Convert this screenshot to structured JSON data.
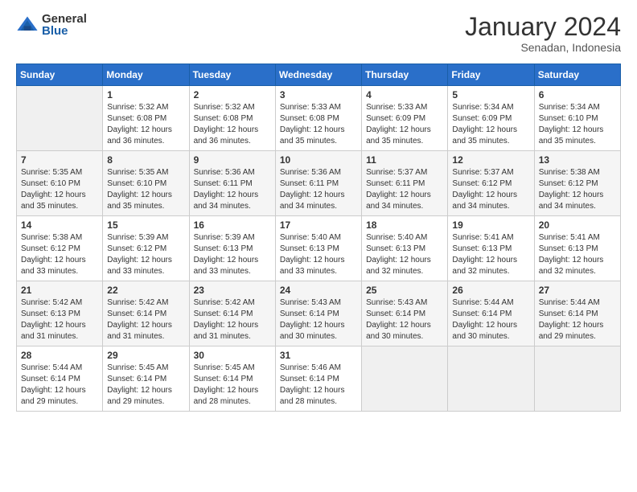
{
  "header": {
    "logo_general": "General",
    "logo_blue": "Blue",
    "month_year": "January 2024",
    "location": "Senadan, Indonesia"
  },
  "days_of_week": [
    "Sunday",
    "Monday",
    "Tuesday",
    "Wednesday",
    "Thursday",
    "Friday",
    "Saturday"
  ],
  "weeks": [
    [
      {
        "day": "",
        "sunrise": "",
        "sunset": "",
        "daylight": ""
      },
      {
        "day": "1",
        "sunrise": "Sunrise: 5:32 AM",
        "sunset": "Sunset: 6:08 PM",
        "daylight": "Daylight: 12 hours and 36 minutes."
      },
      {
        "day": "2",
        "sunrise": "Sunrise: 5:32 AM",
        "sunset": "Sunset: 6:08 PM",
        "daylight": "Daylight: 12 hours and 36 minutes."
      },
      {
        "day": "3",
        "sunrise": "Sunrise: 5:33 AM",
        "sunset": "Sunset: 6:08 PM",
        "daylight": "Daylight: 12 hours and 35 minutes."
      },
      {
        "day": "4",
        "sunrise": "Sunrise: 5:33 AM",
        "sunset": "Sunset: 6:09 PM",
        "daylight": "Daylight: 12 hours and 35 minutes."
      },
      {
        "day": "5",
        "sunrise": "Sunrise: 5:34 AM",
        "sunset": "Sunset: 6:09 PM",
        "daylight": "Daylight: 12 hours and 35 minutes."
      },
      {
        "day": "6",
        "sunrise": "Sunrise: 5:34 AM",
        "sunset": "Sunset: 6:10 PM",
        "daylight": "Daylight: 12 hours and 35 minutes."
      }
    ],
    [
      {
        "day": "7",
        "sunrise": "Sunrise: 5:35 AM",
        "sunset": "Sunset: 6:10 PM",
        "daylight": "Daylight: 12 hours and 35 minutes."
      },
      {
        "day": "8",
        "sunrise": "Sunrise: 5:35 AM",
        "sunset": "Sunset: 6:10 PM",
        "daylight": "Daylight: 12 hours and 35 minutes."
      },
      {
        "day": "9",
        "sunrise": "Sunrise: 5:36 AM",
        "sunset": "Sunset: 6:11 PM",
        "daylight": "Daylight: 12 hours and 34 minutes."
      },
      {
        "day": "10",
        "sunrise": "Sunrise: 5:36 AM",
        "sunset": "Sunset: 6:11 PM",
        "daylight": "Daylight: 12 hours and 34 minutes."
      },
      {
        "day": "11",
        "sunrise": "Sunrise: 5:37 AM",
        "sunset": "Sunset: 6:11 PM",
        "daylight": "Daylight: 12 hours and 34 minutes."
      },
      {
        "day": "12",
        "sunrise": "Sunrise: 5:37 AM",
        "sunset": "Sunset: 6:12 PM",
        "daylight": "Daylight: 12 hours and 34 minutes."
      },
      {
        "day": "13",
        "sunrise": "Sunrise: 5:38 AM",
        "sunset": "Sunset: 6:12 PM",
        "daylight": "Daylight: 12 hours and 34 minutes."
      }
    ],
    [
      {
        "day": "14",
        "sunrise": "Sunrise: 5:38 AM",
        "sunset": "Sunset: 6:12 PM",
        "daylight": "Daylight: 12 hours and 33 minutes."
      },
      {
        "day": "15",
        "sunrise": "Sunrise: 5:39 AM",
        "sunset": "Sunset: 6:12 PM",
        "daylight": "Daylight: 12 hours and 33 minutes."
      },
      {
        "day": "16",
        "sunrise": "Sunrise: 5:39 AM",
        "sunset": "Sunset: 6:13 PM",
        "daylight": "Daylight: 12 hours and 33 minutes."
      },
      {
        "day": "17",
        "sunrise": "Sunrise: 5:40 AM",
        "sunset": "Sunset: 6:13 PM",
        "daylight": "Daylight: 12 hours and 33 minutes."
      },
      {
        "day": "18",
        "sunrise": "Sunrise: 5:40 AM",
        "sunset": "Sunset: 6:13 PM",
        "daylight": "Daylight: 12 hours and 32 minutes."
      },
      {
        "day": "19",
        "sunrise": "Sunrise: 5:41 AM",
        "sunset": "Sunset: 6:13 PM",
        "daylight": "Daylight: 12 hours and 32 minutes."
      },
      {
        "day": "20",
        "sunrise": "Sunrise: 5:41 AM",
        "sunset": "Sunset: 6:13 PM",
        "daylight": "Daylight: 12 hours and 32 minutes."
      }
    ],
    [
      {
        "day": "21",
        "sunrise": "Sunrise: 5:42 AM",
        "sunset": "Sunset: 6:13 PM",
        "daylight": "Daylight: 12 hours and 31 minutes."
      },
      {
        "day": "22",
        "sunrise": "Sunrise: 5:42 AM",
        "sunset": "Sunset: 6:14 PM",
        "daylight": "Daylight: 12 hours and 31 minutes."
      },
      {
        "day": "23",
        "sunrise": "Sunrise: 5:42 AM",
        "sunset": "Sunset: 6:14 PM",
        "daylight": "Daylight: 12 hours and 31 minutes."
      },
      {
        "day": "24",
        "sunrise": "Sunrise: 5:43 AM",
        "sunset": "Sunset: 6:14 PM",
        "daylight": "Daylight: 12 hours and 30 minutes."
      },
      {
        "day": "25",
        "sunrise": "Sunrise: 5:43 AM",
        "sunset": "Sunset: 6:14 PM",
        "daylight": "Daylight: 12 hours and 30 minutes."
      },
      {
        "day": "26",
        "sunrise": "Sunrise: 5:44 AM",
        "sunset": "Sunset: 6:14 PM",
        "daylight": "Daylight: 12 hours and 30 minutes."
      },
      {
        "day": "27",
        "sunrise": "Sunrise: 5:44 AM",
        "sunset": "Sunset: 6:14 PM",
        "daylight": "Daylight: 12 hours and 29 minutes."
      }
    ],
    [
      {
        "day": "28",
        "sunrise": "Sunrise: 5:44 AM",
        "sunset": "Sunset: 6:14 PM",
        "daylight": "Daylight: 12 hours and 29 minutes."
      },
      {
        "day": "29",
        "sunrise": "Sunrise: 5:45 AM",
        "sunset": "Sunset: 6:14 PM",
        "daylight": "Daylight: 12 hours and 29 minutes."
      },
      {
        "day": "30",
        "sunrise": "Sunrise: 5:45 AM",
        "sunset": "Sunset: 6:14 PM",
        "daylight": "Daylight: 12 hours and 28 minutes."
      },
      {
        "day": "31",
        "sunrise": "Sunrise: 5:46 AM",
        "sunset": "Sunset: 6:14 PM",
        "daylight": "Daylight: 12 hours and 28 minutes."
      },
      {
        "day": "",
        "sunrise": "",
        "sunset": "",
        "daylight": ""
      },
      {
        "day": "",
        "sunrise": "",
        "sunset": "",
        "daylight": ""
      },
      {
        "day": "",
        "sunrise": "",
        "sunset": "",
        "daylight": ""
      }
    ]
  ]
}
